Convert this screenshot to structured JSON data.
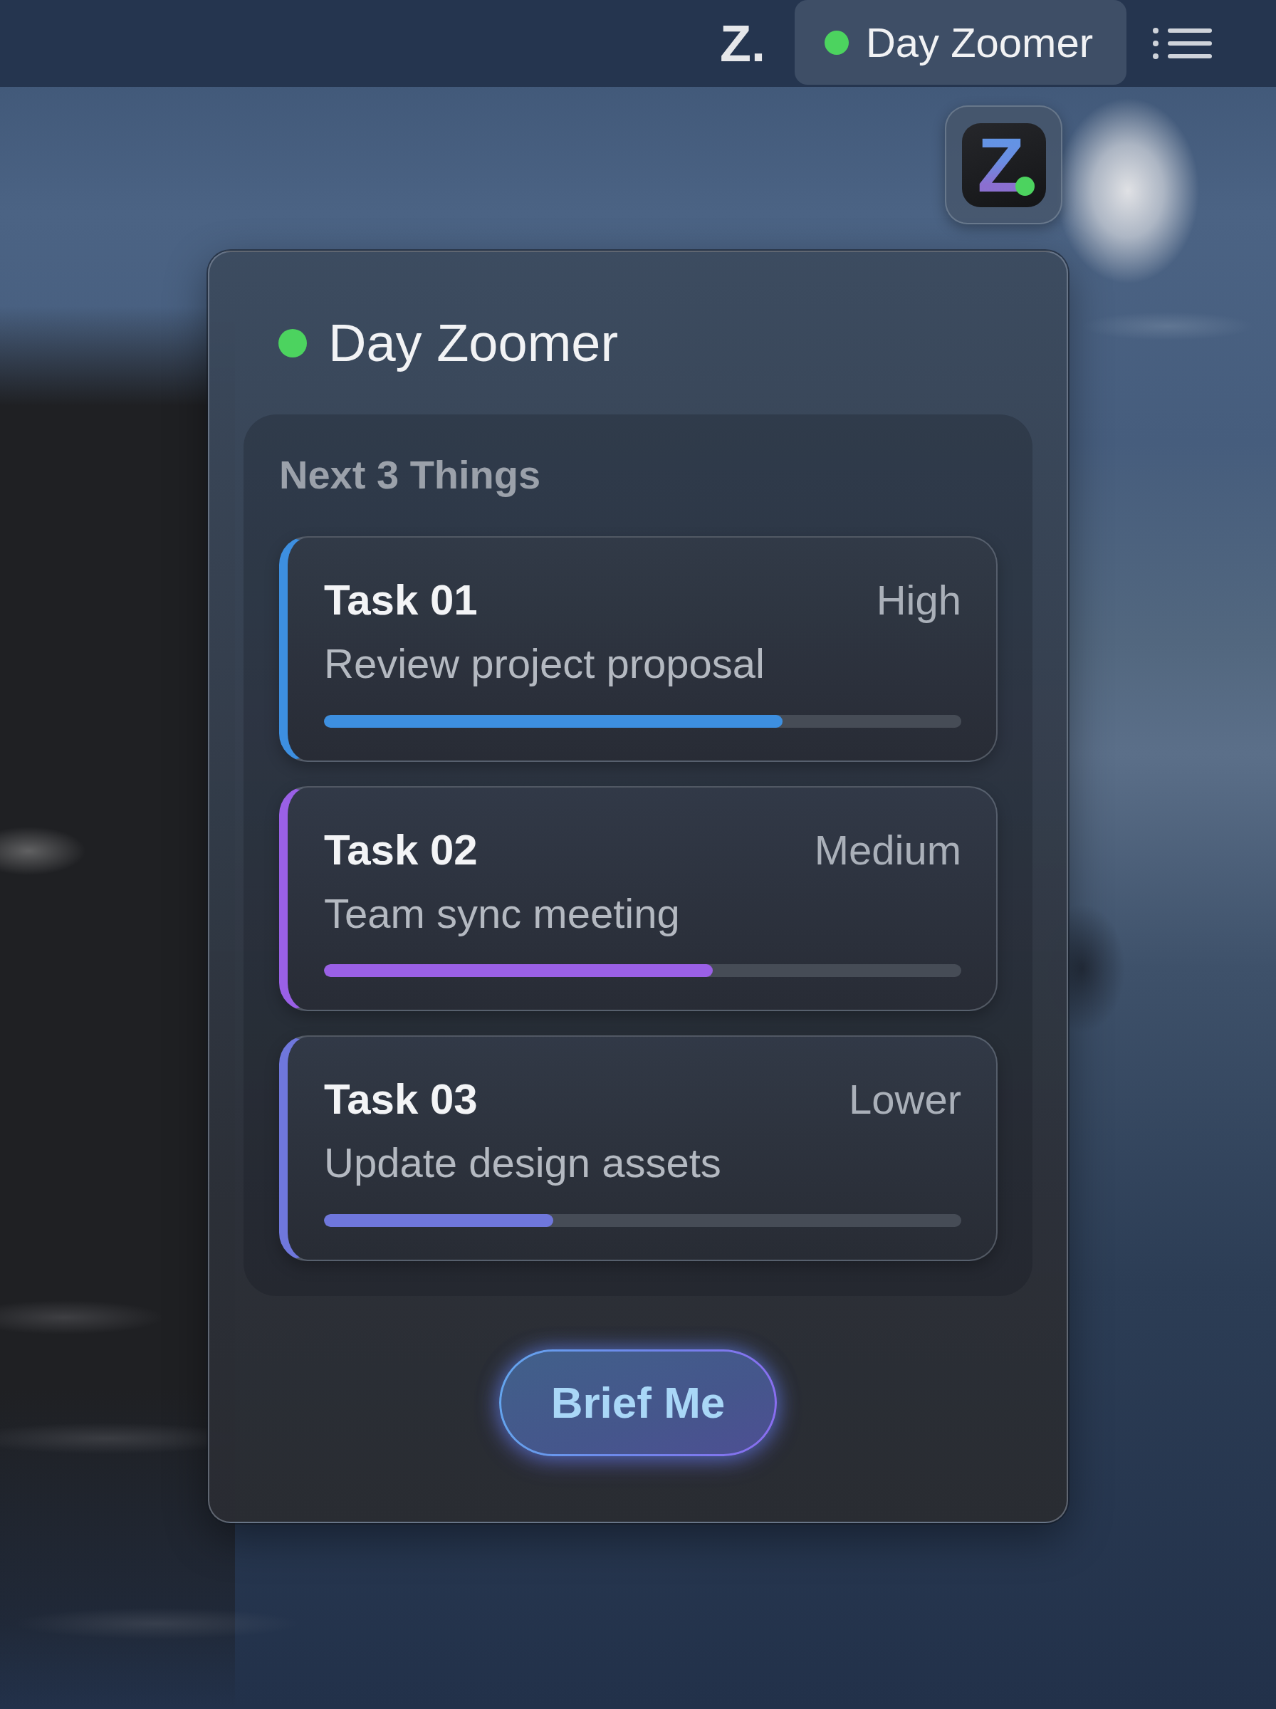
{
  "menubar": {
    "logo": "Z.",
    "app": {
      "title": "Day Zoomer",
      "online": true
    }
  },
  "app_icon": {
    "letter": "Z"
  },
  "panel": {
    "title": "Day Zoomer",
    "online": true,
    "section": {
      "title": "Next 3 Things",
      "tasks": [
        {
          "title": "Task 01",
          "priority": "High",
          "description": "Review project proposal",
          "level": 0.72,
          "color": "#3d8fe0"
        },
        {
          "title": "Task 02",
          "priority": "Medium",
          "description": "Team sync meeting",
          "level": 0.61,
          "color": "#9a60e6"
        },
        {
          "title": "Task 03",
          "priority": "Lower",
          "description": "Update design assets",
          "level": 0.36,
          "color": "#6f77dc"
        }
      ]
    },
    "button": "Brief Me"
  }
}
